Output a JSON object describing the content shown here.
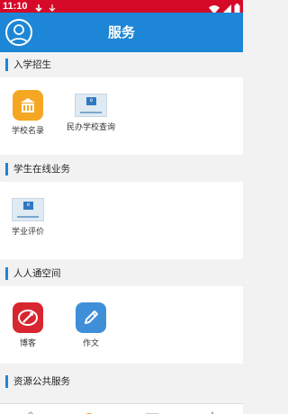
{
  "status_bar": {
    "time": "11:10"
  },
  "header": {
    "title": "服务"
  },
  "sections": [
    {
      "title": "入学招生",
      "tiles": [
        {
          "label": "学校名录"
        },
        {
          "label": "民办学校查询"
        }
      ]
    },
    {
      "title": "学生在线业务",
      "tiles": [
        {
          "label": "学业评价"
        }
      ]
    },
    {
      "title": "人人通空间",
      "tiles": [
        {
          "label": "博客"
        },
        {
          "label": "作文"
        }
      ]
    },
    {
      "title": "资源公共服务",
      "tiles": []
    }
  ],
  "colors": {
    "status_bar": "#d40a28",
    "header": "#1d86d6",
    "accent": "#1d86d6"
  }
}
